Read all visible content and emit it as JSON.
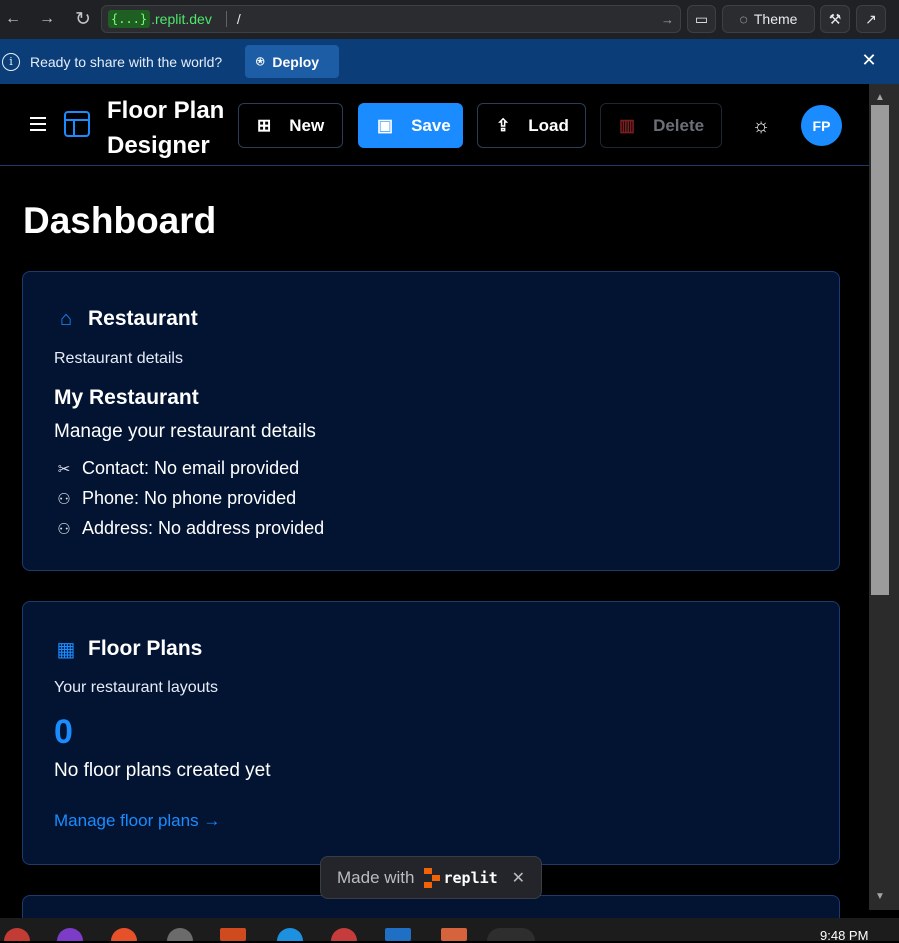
{
  "browser": {
    "url_tag": "{...}",
    "url_host": ".replit.dev",
    "url_path": "/",
    "theme_label": "Theme"
  },
  "banner": {
    "text": "Ready to share with the world?",
    "deploy_label": "Deploy"
  },
  "header": {
    "title": "Floor Plan Designer",
    "buttons": {
      "new": "New",
      "save": "Save",
      "load": "Load",
      "delete": "Delete"
    },
    "avatar_initials": "FP"
  },
  "dashboard": {
    "title": "Dashboard",
    "restaurant_card": {
      "title": "Restaurant",
      "subtitle": "Restaurant details",
      "name": "My Restaurant",
      "manage": "Manage your restaurant details",
      "contact": "Contact: No email provided",
      "phone": "Phone: No phone provided",
      "address": "Address: No address provided"
    },
    "floorplans_card": {
      "title": "Floor Plans",
      "subtitle": "Your restaurant layouts",
      "count": "0",
      "empty_text": "No floor plans created yet",
      "link": "Manage floor plans →"
    }
  },
  "made_with": {
    "label": "Made with",
    "brand": "replit"
  },
  "taskbar": {
    "time": "9:48 PM"
  },
  "colors": {
    "accent": "#1a8cff",
    "card_bg": "#031433",
    "banner_bg": "#0b3e78"
  }
}
